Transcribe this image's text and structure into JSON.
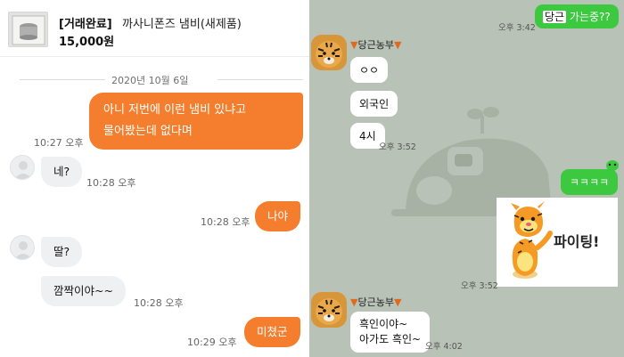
{
  "left": {
    "product": {
      "status": "[거래완료]",
      "title": "까사니폰즈 냄비(새제품)",
      "price": "15,000원"
    },
    "date_separator": "2020년 10월 6일",
    "messages": [
      {
        "id": "m1",
        "from": "me",
        "text_line1": "아니 저번에 이런 냄비 있냐고",
        "text_line2": "물어봤는데 없다며",
        "time": "10:27 오후"
      },
      {
        "id": "m2",
        "from": "them",
        "text": "네?",
        "time": "10:28 오후"
      },
      {
        "id": "m3",
        "from": "me",
        "text": "나야",
        "time": "10:28 오후"
      },
      {
        "id": "m4",
        "from": "them",
        "text": "딸?"
      },
      {
        "id": "m5",
        "from": "them",
        "text": "깜짝이야~~",
        "time": "10:28 오후"
      },
      {
        "id": "m6",
        "from": "me",
        "text": "미쳤군",
        "time": "10:29 오후"
      }
    ]
  },
  "right": {
    "colors": {
      "background": "#b9c2b6",
      "me_bubble": "#3cc940",
      "them_bubble": "#ffffff"
    },
    "messages": [
      {
        "id": "r1",
        "from": "me",
        "text_green": "당근",
        "text_rest": " 가는중??",
        "time": "오후 3:42"
      },
      {
        "id": "r2",
        "from": "them",
        "name": "당근농부",
        "bubbles": [
          "ㅇㅇ",
          "외국인",
          "4시"
        ],
        "time": "오후 3:52"
      },
      {
        "id": "r3",
        "from": "me",
        "text": "ㅋㅋㅋㅋ"
      },
      {
        "id": "r4",
        "from": "me",
        "sticker": "tigger-fighting-sticker",
        "sticker_text": "파이팅!",
        "time": "오후 3:52"
      },
      {
        "id": "r5",
        "from": "them",
        "name": "당근농부",
        "text_line1": "흑인이야~",
        "text_line2": "아가도 흑인~",
        "time": "오후 4:02"
      }
    ]
  }
}
